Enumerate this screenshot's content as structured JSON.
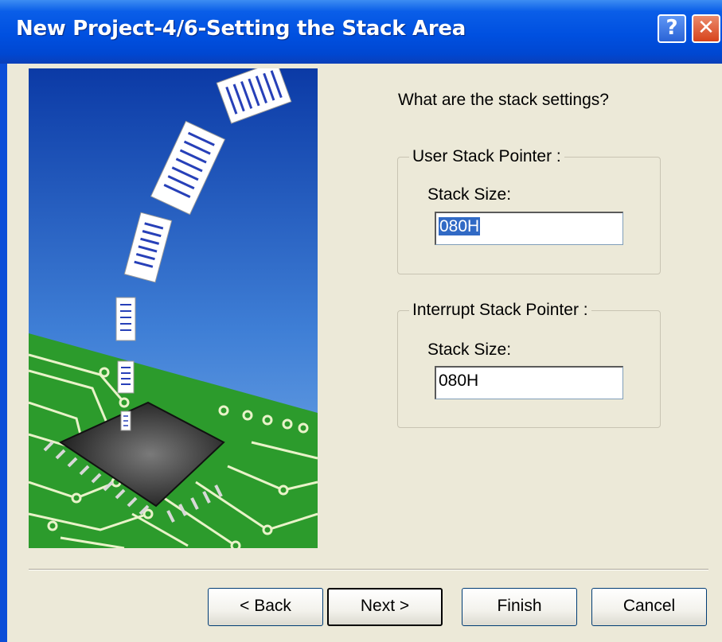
{
  "window": {
    "title": "New Project-4/6-Setting the Stack Area",
    "help_glyph": "?",
    "close_glyph": "✕"
  },
  "content": {
    "prompt": "What are the stack settings?",
    "user_group": {
      "legend": "User Stack Pointer :",
      "label": "Stack Size:",
      "value": "080H"
    },
    "interrupt_group": {
      "legend": "Interrupt Stack Pointer :",
      "label": "Stack Size:",
      "value": "080H"
    }
  },
  "buttons": {
    "back": "< Back",
    "next": "Next >",
    "finish": "Finish",
    "cancel": "Cancel"
  },
  "colors": {
    "titlebar": "#0050e0",
    "selection": "#316ac5",
    "pcb_green": "#2c9b2c"
  }
}
